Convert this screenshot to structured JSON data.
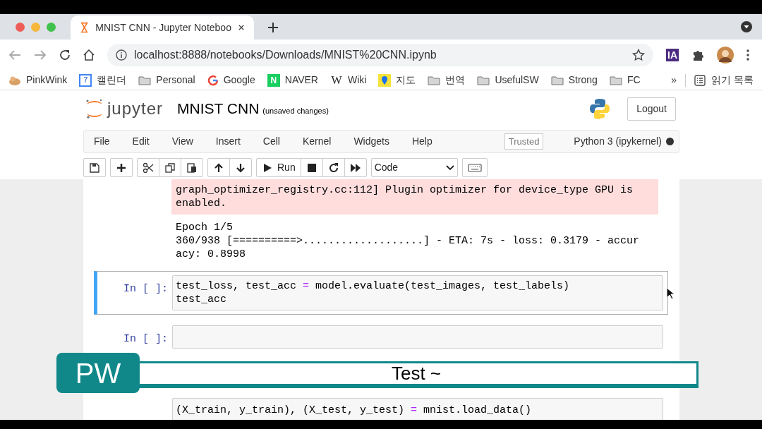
{
  "browser": {
    "tabs": [
      {
        "title": "MNIST CNN - Jupyter Noteboo",
        "selected": true
      }
    ],
    "address": "localhost:8888/notebooks/Downloads/MNIST%20CNN.ipynb",
    "extension_badge": "IA",
    "bookmarks": [
      {
        "label": "PinkWink",
        "kind": "avatar"
      },
      {
        "label": "캘린더",
        "kind": "calendar",
        "badge": "7"
      },
      {
        "label": "Personal",
        "kind": "folder"
      },
      {
        "label": "Google",
        "kind": "google"
      },
      {
        "label": "NAVER",
        "kind": "naver",
        "badge": "N"
      },
      {
        "label": "Wiki",
        "kind": "wiki",
        "badge": "W"
      },
      {
        "label": "지도",
        "kind": "map"
      },
      {
        "label": "번역",
        "kind": "folder"
      },
      {
        "label": "UsefulSW",
        "kind": "folder"
      },
      {
        "label": "Strong",
        "kind": "folder"
      },
      {
        "label": "FC",
        "kind": "folder"
      }
    ],
    "overflow": "»",
    "reading_list": "읽기 목록"
  },
  "jupyter": {
    "logo_text": "jupyter",
    "notebook_title": "MNIST CNN",
    "save_status": "(unsaved changes)",
    "logout": "Logout",
    "menu": [
      "File",
      "Edit",
      "View",
      "Insert",
      "Cell",
      "Kernel",
      "Widgets",
      "Help"
    ],
    "trusted": "Trusted",
    "kernel": "Python 3 (ipykernel)",
    "kernel_busy": true,
    "toolbar": [
      [
        {
          "kind": "save"
        }
      ],
      [
        {
          "kind": "add"
        }
      ],
      [
        {
          "kind": "cut"
        },
        {
          "kind": "copy"
        },
        {
          "kind": "paste"
        }
      ],
      [
        {
          "kind": "up"
        },
        {
          "kind": "down"
        }
      ],
      [
        {
          "kind": "run",
          "label": "Run"
        },
        {
          "kind": "stop"
        },
        {
          "kind": "restart"
        },
        {
          "kind": "fastforward"
        }
      ],
      [
        {
          "kind": "select",
          "label": "Code"
        }
      ],
      [
        {
          "kind": "keyboard"
        }
      ]
    ]
  },
  "cells": [
    {
      "kind": "output",
      "outputs": [
        {
          "kind": "stderr",
          "lines": [
            "graph_optimizer_registry.cc:112] Plugin optimizer for device_type GPU is",
            "enabled."
          ]
        },
        {
          "kind": "stdout",
          "lines": [
            "Epoch 1/5",
            "360/938 [==========>...................] - ETA: 7s - loss: 0.3179 - accur",
            "acy: 0.8998"
          ]
        }
      ]
    },
    {
      "kind": "code",
      "prompt": "In [ ]:",
      "selected": true,
      "lines": [
        [
          {
            "text": "test_loss, test_acc ",
            "kind": "plain"
          },
          {
            "text": "=",
            "kind": "op"
          },
          {
            "text": " model.evaluate(test_images, test_labels)",
            "kind": "plain"
          }
        ],
        [
          {
            "text": "test_acc",
            "kind": "plain"
          }
        ]
      ]
    },
    {
      "kind": "code",
      "prompt": "In [ ]:",
      "selected": false
    },
    {
      "kind": "code_hidden",
      "selected": false,
      "lines": [
        [
          {
            "text": "(X_train, y_train), (X_test, y_test) ",
            "kind": "plain"
          },
          {
            "text": "=",
            "kind": "op"
          },
          {
            "text": " mnist.load_data()",
            "kind": "plain"
          }
        ]
      ]
    }
  ],
  "caption": {
    "badge": "PW",
    "text": "Test ~"
  }
}
